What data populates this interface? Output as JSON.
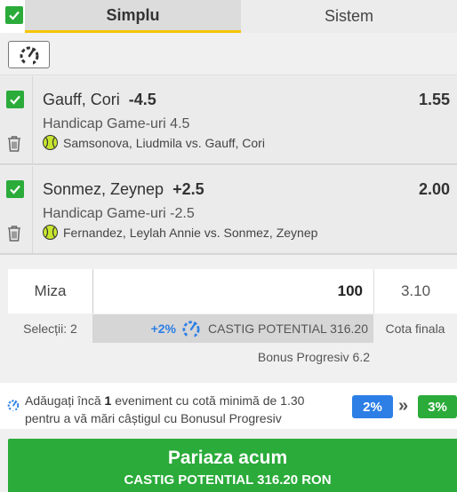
{
  "tabs": [
    {
      "label": "Simplu",
      "active": true
    },
    {
      "label": "Sistem",
      "active": false
    }
  ],
  "selections": [
    {
      "participant": "Gauff, Cori",
      "handicap": "-4.5",
      "odd": "1.55",
      "market": "Handicap Game-uri 4.5",
      "event": "Samsonova, Liudmila vs. Gauff, Cori",
      "sport_icon": "tennis-ball-icon"
    },
    {
      "participant": "Sonmez, Zeynep",
      "handicap": "+2.5",
      "odd": "2.00",
      "market": "Handicap Game-uri -2.5",
      "event": "Fernandez, Leylah Annie vs. Sonmez, Zeynep",
      "sport_icon": "tennis-ball-icon"
    }
  ],
  "stake": {
    "label": "Miza",
    "amount": "100",
    "total_odds": "3.10"
  },
  "summary": {
    "selections_label": "Selecții: 2",
    "bonus_pct": "+2%",
    "potential_win": "CASTIG POTENTIAL 316.20",
    "final_odds_label": "Cota finala",
    "bonus_progresiv": "Bonus Progresiv 6.2"
  },
  "promo": {
    "text_before": "Adăugați încă ",
    "count": "1",
    "text_after": " eveniment cu cotă minimă de 1.30 pentru a vă mări câștigul cu Bonusul Progresiv",
    "current_pct": "2%",
    "next_pct": "3%",
    "arrows": "»"
  },
  "bet_button": {
    "title": "Pariaza acum",
    "subtitle": "CASTIG POTENTIAL  316.20 RON"
  },
  "colors": {
    "green": "#2bab3a",
    "blue": "#2d7fe6",
    "tab_underline": "#f5c400"
  }
}
